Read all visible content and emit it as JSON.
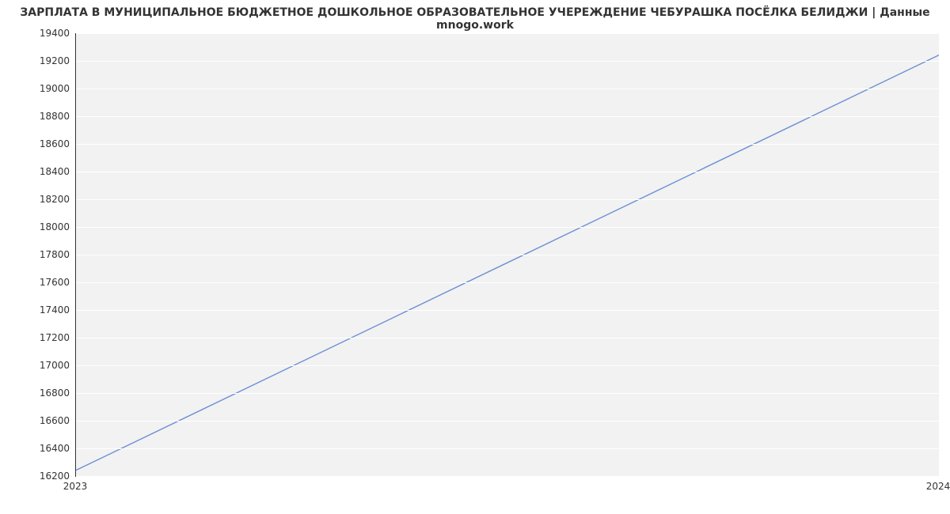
{
  "chart_data": {
    "type": "line",
    "title": "ЗАРПЛАТА В МУНИЦИПАЛЬНОЕ БЮДЖЕТНОЕ ДОШКОЛЬНОЕ ОБРАЗОВАТЕЛЬНОЕ УЧЕРЕЖДЕНИЕ ЧЕБУРАШКА ПОСЁЛКА БЕЛИДЖИ | Данные mnogo.work",
    "xlabel": "",
    "ylabel": "",
    "x": [
      2023,
      2024
    ],
    "values": [
      16242,
      19242
    ],
    "x_ticks": [
      2023,
      2024
    ],
    "y_ticks": [
      16200,
      16400,
      16600,
      16800,
      17000,
      17200,
      17400,
      17600,
      17800,
      18000,
      18200,
      18400,
      18600,
      18800,
      19000,
      19200,
      19400
    ],
    "xlim": [
      2023,
      2024
    ],
    "ylim": [
      16200,
      19400
    ],
    "line_color": "#6b8fd4",
    "grid": true,
    "legend": false
  }
}
